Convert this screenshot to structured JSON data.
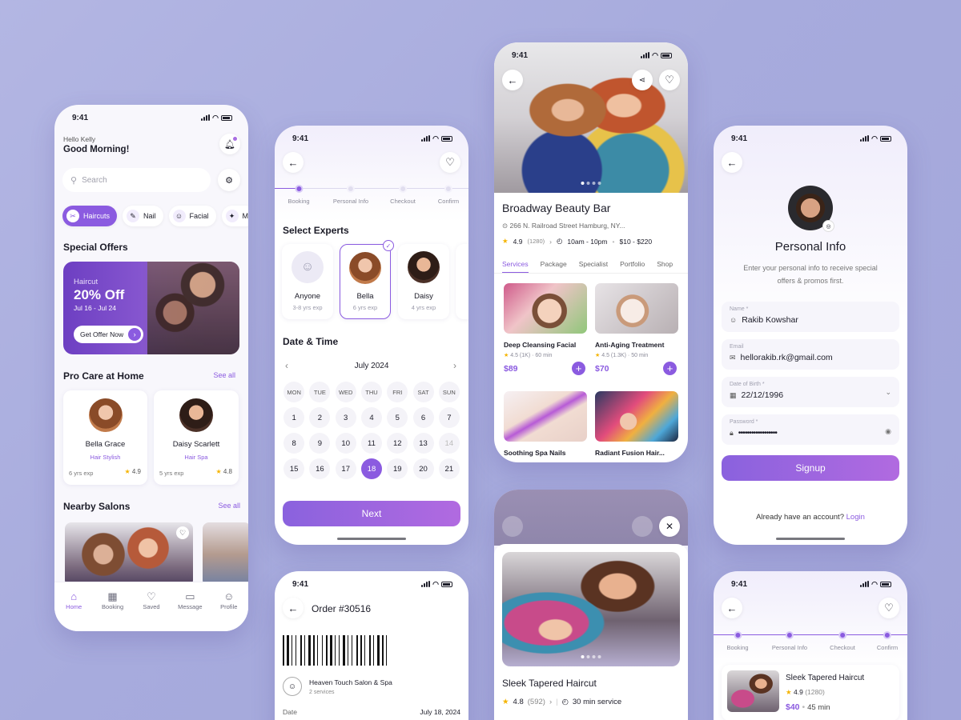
{
  "status_time": "9:41",
  "home": {
    "greeting": "Hello Kelly",
    "title": "Good Morning!",
    "search_placeholder": "Search",
    "categories": [
      {
        "label": "Haircuts",
        "icon": "scissors-icon",
        "active": true
      },
      {
        "label": "Nail",
        "icon": "nail-icon",
        "active": false
      },
      {
        "label": "Facial",
        "icon": "facial-icon",
        "active": false
      },
      {
        "label": "M",
        "icon": "makeup-icon",
        "active": false
      }
    ],
    "offers_title": "Special Offers",
    "offer": {
      "tag": "Haircut",
      "discount": "20% Off",
      "dates": "Jul 16 - Jul 24",
      "cta": "Get Offer Now"
    },
    "procare_title": "Pro Care at Home",
    "see_all": "See all",
    "experts": [
      {
        "name": "Bella Grace",
        "role": "Hair Stylish",
        "exp": "6 yrs exp",
        "rating": "4.9"
      },
      {
        "name": "Daisy Scarlett",
        "role": "Hair Spa",
        "exp": "5 yrs exp",
        "rating": "4.8"
      }
    ],
    "nearby_title": "Nearby Salons",
    "nearby_see_all": "See all",
    "tabs": [
      {
        "label": "Home",
        "icon": "home-icon"
      },
      {
        "label": "Booking",
        "icon": "calendar-icon"
      },
      {
        "label": "Saved",
        "icon": "heart-icon"
      },
      {
        "label": "Message",
        "icon": "message-icon"
      },
      {
        "label": "Profile",
        "icon": "profile-icon"
      }
    ]
  },
  "booking": {
    "steps": [
      "Booking",
      "Personal Info",
      "Checkout",
      "Confirm"
    ],
    "experts_title": "Select Experts",
    "experts": [
      {
        "name": "Anyone",
        "exp": "3-8 yrs exp"
      },
      {
        "name": "Bella",
        "exp": "6 yrs exp"
      },
      {
        "name": "Daisy",
        "exp": "4 yrs exp"
      }
    ],
    "datetime_title": "Date & Time",
    "month": "July 2024",
    "weekdays": [
      "MON",
      "TUE",
      "WED",
      "THU",
      "FRI",
      "SAT",
      "SUN"
    ],
    "days": [
      "1",
      "2",
      "3",
      "4",
      "5",
      "6",
      "7",
      "8",
      "9",
      "10",
      "11",
      "12",
      "13",
      "14",
      "15",
      "16",
      "17",
      "18",
      "19",
      "20",
      "21"
    ],
    "selected_day": "18",
    "next_label": "Next"
  },
  "salon": {
    "name": "Broadway Beauty Bar",
    "address": "266 N. Railroad Street Hamburg, NY...",
    "rating": "4.9",
    "reviews": "(1280)",
    "hours": "10am - 10pm",
    "price_range": "$10 - $220",
    "tabs": [
      "Services",
      "Package",
      "Specialist",
      "Portfolio",
      "Shop"
    ],
    "services": [
      {
        "name": "Deep Cleansing Facial",
        "rating": "4.5",
        "count": "(1K)",
        "time": "60 min",
        "price": "$89"
      },
      {
        "name": "Anti-Aging Treatment",
        "rating": "4.5",
        "count": "(1.3K)",
        "time": "50 min",
        "price": "$70"
      },
      {
        "name": "Soothing Spa Nails",
        "rating": "",
        "count": "",
        "time": "",
        "price": ""
      },
      {
        "name": "Radiant Fusion Hair...",
        "rating": "",
        "count": "",
        "time": "",
        "price": ""
      }
    ]
  },
  "personal": {
    "title": "Personal Info",
    "subtitle": "Enter your personal info to receive special offers & promos first.",
    "fields": [
      {
        "label": "Name *",
        "value": "Rakib Kowshar",
        "icon": "user-icon"
      },
      {
        "label": "Email",
        "value": "hellorakib.rk@gmail.com",
        "icon": "mail-icon"
      },
      {
        "label": "Date of Birth *",
        "value": "22/12/1996",
        "icon": "calendar-icon"
      },
      {
        "label": "Password *",
        "value": "••••••••••••••••••",
        "icon": "lock-icon"
      }
    ],
    "signup": "Signup",
    "have_account": "Already have an account?",
    "login": "Login"
  },
  "order": {
    "title": "Order #30516",
    "salon": "Heaven Touch Salon & Spa",
    "services": "2 services",
    "date_label": "Date",
    "date_value": "July 18, 2024"
  },
  "haircut": {
    "name": "Sleek Tapered Haircut",
    "rating": "4.8",
    "reviews": "(592)",
    "duration": "30 min service"
  },
  "checkout": {
    "steps": [
      "Booking",
      "Personal Info",
      "Checkout",
      "Confirm"
    ],
    "name": "Sleek Tapered Haircut",
    "rating": "4.9",
    "reviews": "(1280)",
    "price": "$40",
    "duration": "45 min"
  },
  "colors": {
    "accent": "#8b5be0",
    "background": "#a9addf"
  }
}
